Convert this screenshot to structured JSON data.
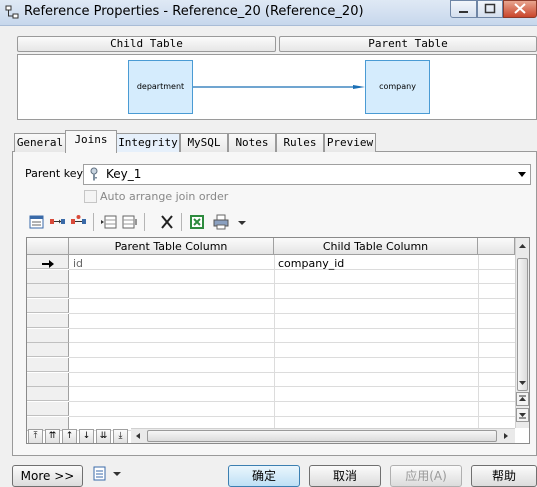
{
  "window": {
    "title": "Reference Properties - Reference_20 (Reference_20)"
  },
  "diagram": {
    "child_table_header": "Child Table",
    "parent_table_header": "Parent Table",
    "child_table": "department",
    "parent_table": "company"
  },
  "tabs": [
    {
      "label": "General"
    },
    {
      "label": "Joins"
    },
    {
      "label": "Integrity"
    },
    {
      "label": "MySQL"
    },
    {
      "label": "Notes"
    },
    {
      "label": "Rules"
    },
    {
      "label": "Preview"
    }
  ],
  "joins": {
    "parent_key_label": "Parent key:",
    "parent_key_value": "Key_1",
    "auto_arrange_label": "Auto arrange join order",
    "columns": [
      "Parent Table Column",
      "Child Table Column"
    ],
    "rows": [
      {
        "parent": "id",
        "child": "company_id"
      }
    ]
  },
  "buttons": {
    "more": "More >>",
    "ok": "确定",
    "cancel": "取消",
    "apply": "应用(A)",
    "help": "帮助"
  },
  "colors": {
    "table_box_fill": "#d5ecfd",
    "table_box_border": "#4a9bd4",
    "reference_arrow": "#1a6fb5"
  }
}
